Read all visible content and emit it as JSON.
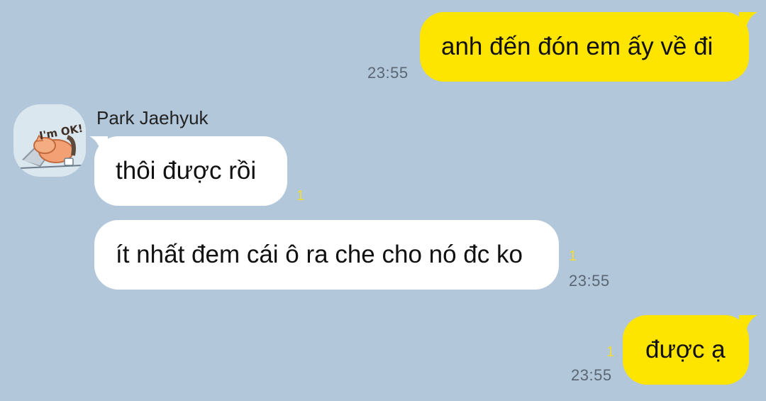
{
  "messages": [
    {
      "direction": "sent",
      "text": "anh đến đón em ấy về đi",
      "time": "23:55"
    },
    {
      "direction": "received",
      "sender": "Park Jaehyuk",
      "text": "thôi được rồi",
      "unread": "1"
    },
    {
      "direction": "received",
      "text": "ít nhất đem cái ô ra che cho nó đc ko",
      "unread": "1",
      "time": "23:55"
    },
    {
      "direction": "sent",
      "text": "được ạ",
      "unread": "1",
      "time": "23:55"
    }
  ],
  "avatar": {
    "icon": "sticker-cat-laptop-icon",
    "sticker_text": "I'm OK!"
  },
  "colors": {
    "background": "#b2c7da",
    "sent_bubble": "#fee500",
    "received_bubble": "#ffffff",
    "unread_count": "#f0dd33",
    "timestamp": "#5a6673"
  }
}
